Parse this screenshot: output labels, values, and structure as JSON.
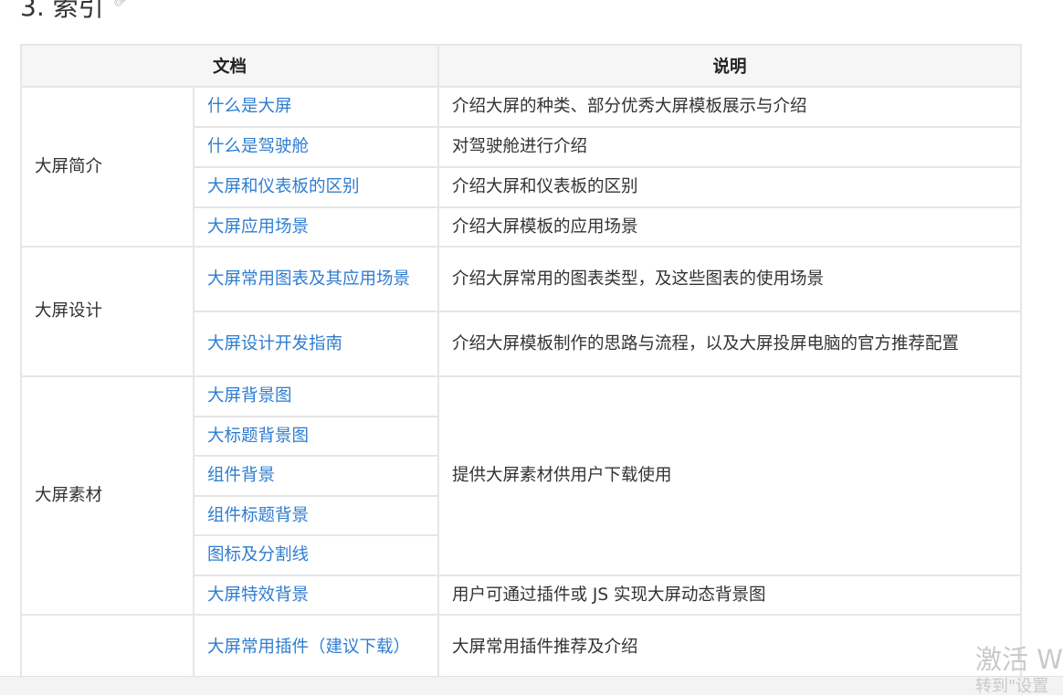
{
  "heading": {
    "text": "3. 索引"
  },
  "table": {
    "col_doc": "文档",
    "col_desc": "说明",
    "rows": [
      {
        "category": "大屏简介",
        "link": "什么是大屏",
        "desc": "介绍大屏的种类、部分优秀大屏模板展示与介绍"
      },
      {
        "link": "什么是驾驶舱",
        "desc": "对驾驶舱进行介绍"
      },
      {
        "link": "大屏和仪表板的区别",
        "desc": "介绍大屏和仪表板的区别"
      },
      {
        "link": "大屏应用场景",
        "desc": "介绍大屏模板的应用场景"
      },
      {
        "category": "大屏设计",
        "link": "大屏常用图表及其应用场景",
        "desc": "介绍大屏常用的图表类型，及这些图表的使用场景"
      },
      {
        "link": "大屏设计开发指南",
        "desc": "介绍大屏模板制作的思路与流程，以及大屏投屏电脑的官方推荐配置"
      },
      {
        "category": "大屏素材",
        "link": "大屏背景图",
        "desc": "提供大屏素材供用户下载使用"
      },
      {
        "link": "大标题背景图"
      },
      {
        "link": "组件背景"
      },
      {
        "link": "组件标题背景"
      },
      {
        "link": "图标及分割线"
      },
      {
        "link": "大屏特效背景",
        "desc": "用户可通过插件或 JS 实现大屏动态背景图"
      },
      {
        "link": "大屏常用插件（建议下载）",
        "desc": "大屏常用插件推荐及介绍"
      }
    ]
  },
  "watermark": {
    "line1": "激活 W",
    "line2": "转到\"设置"
  }
}
